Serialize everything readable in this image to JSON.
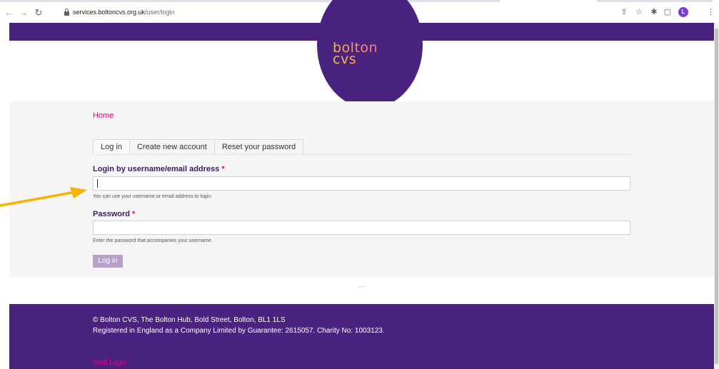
{
  "browser": {
    "url_host": "services.boltoncvs.org.uk",
    "url_path": "/user/login",
    "avatar_letter": "L"
  },
  "site": {
    "logo_line1": "bolton",
    "logo_line2": "cvs",
    "colors": {
      "brand_purple": "#4a2380",
      "link_pink": "#e5007e",
      "logo_orange": "#ffb347"
    }
  },
  "breadcrumb": {
    "home": "Home"
  },
  "tabs": [
    {
      "label": "Log in"
    },
    {
      "label": "Create new account"
    },
    {
      "label": "Reset your password"
    }
  ],
  "form": {
    "username": {
      "label": "Login by username/email address",
      "required_mark": "*",
      "value": "",
      "help": "You can use your username or email address to login."
    },
    "password": {
      "label": "Password",
      "required_mark": "*",
      "value": "",
      "help": "Enter the password that accompanies your username."
    },
    "submit_label": "Log in"
  },
  "footer": {
    "address": "© Bolton CVS, The Bolton Hub, Bold Street, Bolton, BL1 1LS",
    "registration": "Registered in England as a Company Limited by Guarantee: 2615057. Charity No: 1003123.",
    "staff_login": "Staff Login"
  },
  "icons": {
    "back": "back-arrow-icon",
    "forward": "forward-arrow-icon",
    "reload": "reload-icon",
    "lock": "lock-icon",
    "share": "share-icon",
    "bookmark": "star-icon",
    "extensions": "puzzle-icon",
    "sidepanel": "side-panel-icon",
    "menu": "kebab-menu-icon",
    "annotation_color": "#f5b400"
  }
}
